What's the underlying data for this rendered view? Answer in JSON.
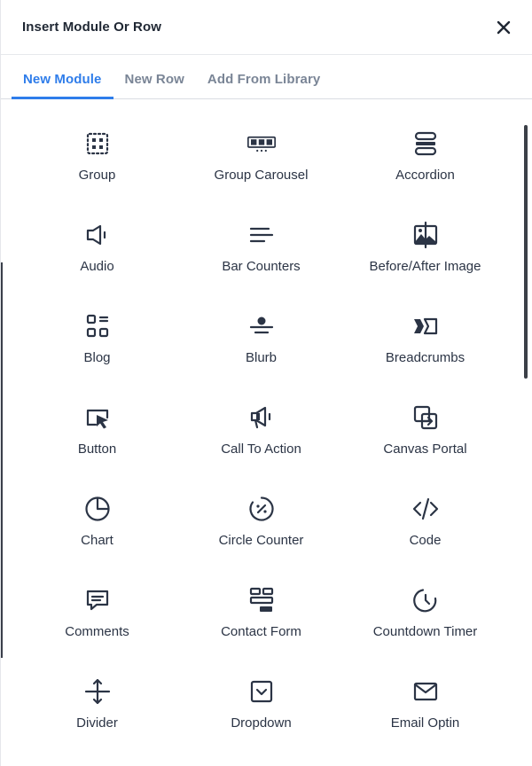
{
  "dialog": {
    "title": "Insert Module Or Row"
  },
  "tabs": [
    {
      "label": "New Module"
    },
    {
      "label": "New Row"
    },
    {
      "label": "Add From Library"
    }
  ],
  "modules": [
    {
      "label": "Group",
      "icon": "group-icon"
    },
    {
      "label": "Group Carousel",
      "icon": "group-carousel-icon"
    },
    {
      "label": "Accordion",
      "icon": "accordion-icon"
    },
    {
      "label": "Audio",
      "icon": "audio-icon"
    },
    {
      "label": "Bar Counters",
      "icon": "bar-counters-icon"
    },
    {
      "label": "Before/After Image",
      "icon": "before-after-image-icon"
    },
    {
      "label": "Blog",
      "icon": "blog-icon"
    },
    {
      "label": "Blurb",
      "icon": "blurb-icon"
    },
    {
      "label": "Breadcrumbs",
      "icon": "breadcrumbs-icon"
    },
    {
      "label": "Button",
      "icon": "button-icon"
    },
    {
      "label": "Call To Action",
      "icon": "call-to-action-icon"
    },
    {
      "label": "Canvas Portal",
      "icon": "canvas-portal-icon"
    },
    {
      "label": "Chart",
      "icon": "chart-icon"
    },
    {
      "label": "Circle Counter",
      "icon": "circle-counter-icon"
    },
    {
      "label": "Code",
      "icon": "code-icon"
    },
    {
      "label": "Comments",
      "icon": "comments-icon"
    },
    {
      "label": "Contact Form",
      "icon": "contact-form-icon"
    },
    {
      "label": "Countdown Timer",
      "icon": "countdown-timer-icon"
    },
    {
      "label": "Divider",
      "icon": "divider-icon"
    },
    {
      "label": "Dropdown",
      "icon": "dropdown-icon"
    },
    {
      "label": "Email Optin",
      "icon": "email-optin-icon"
    }
  ],
  "colors": {
    "accent": "#2f7dea",
    "text": "#2b3445",
    "muted": "#7a8596"
  }
}
